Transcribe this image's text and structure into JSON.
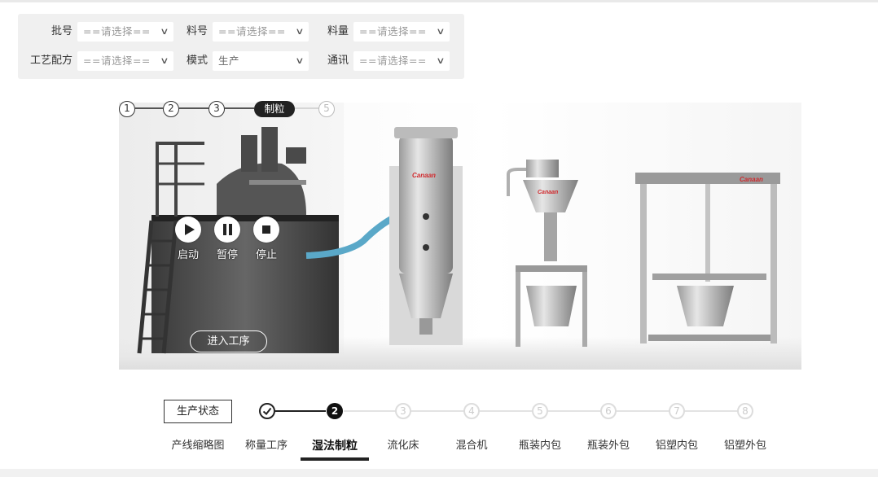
{
  "filters": [
    {
      "label": "批号",
      "value": "==请选择=="
    },
    {
      "label": "料号",
      "value": "==请选择=="
    },
    {
      "label": "料量",
      "value": "==请选择=="
    },
    {
      "label": "工艺配方",
      "value": "==请选择=="
    },
    {
      "label": "模式",
      "value": "生产"
    },
    {
      "label": "通讯",
      "value": "==请选择=="
    }
  ],
  "process_steps": [
    "1",
    "2",
    "3",
    "制粒",
    "5"
  ],
  "controls": {
    "start": "启动",
    "pause": "暂停",
    "stop": "停止"
  },
  "enter_process": "进入工序",
  "brand": "Canaan",
  "production_status_label": "生产状态",
  "progress_steps": [
    "2",
    "3",
    "4",
    "5",
    "6",
    "7",
    "8"
  ],
  "tabs": [
    "产线缩略图",
    "称量工序",
    "湿法制粒",
    "流化床",
    "混合机",
    "瓶装内包",
    "瓶装外包",
    "铝塑内包",
    "铝塑外包"
  ],
  "active_tab": "湿法制粒"
}
